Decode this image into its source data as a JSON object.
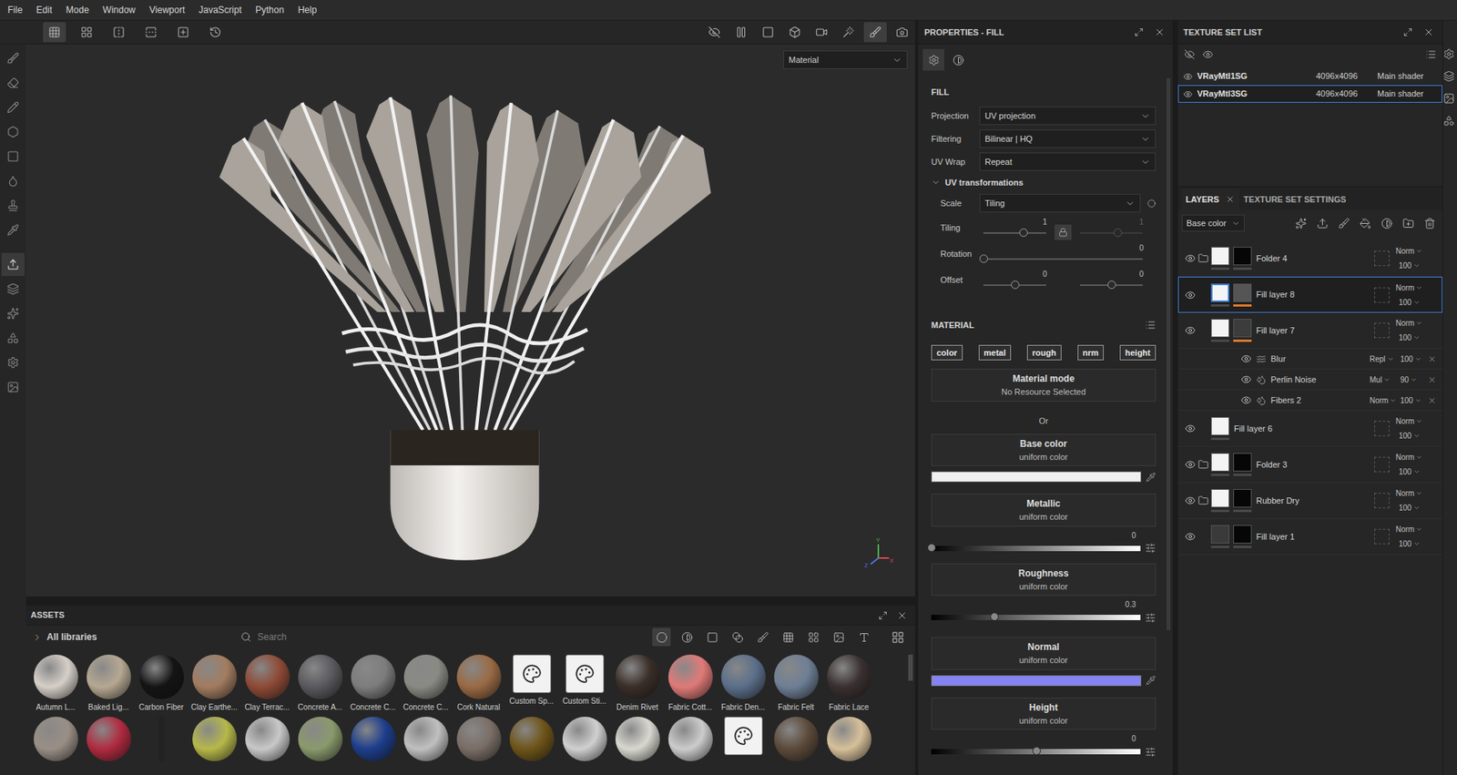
{
  "menu": [
    "File",
    "Edit",
    "Mode",
    "Window",
    "Viewport",
    "JavaScript",
    "Python",
    "Help"
  ],
  "viewport": {
    "shading": "Material",
    "axes": [
      "Y",
      "X",
      "Z"
    ]
  },
  "properties": {
    "title": "PROPERTIES - FILL",
    "tabs": [
      {
        "selected": true
      },
      {
        "selected": false
      }
    ],
    "section": "FILL",
    "fields": [
      {
        "label": "Projection",
        "value": "UV projection"
      },
      {
        "label": "Filtering",
        "value": "Bilinear | HQ"
      },
      {
        "label": "UV Wrap",
        "value": "Repeat"
      }
    ],
    "uv": {
      "title": "UV transformations",
      "expanded": true
    },
    "scale": {
      "label": "Scale",
      "value": "Tiling"
    },
    "sliders": [
      {
        "label": "Tiling",
        "locked": true,
        "tracks": [
          {
            "reading": "1",
            "level": 0.63,
            "disabled": false
          },
          {
            "reading": "1",
            "level": 0.6,
            "disabled": true
          }
        ]
      },
      {
        "label": "Rotation",
        "tracks": [
          {
            "reading": "0",
            "level": 0,
            "disabled": false
          }
        ]
      },
      {
        "label": "Offset",
        "tracks": [
          {
            "reading": "0",
            "level": 0.5,
            "disabled": false
          },
          {
            "reading": "0",
            "level": 0.5,
            "disabled": false
          }
        ]
      }
    ],
    "material": {
      "title": "MATERIAL",
      "channels": [
        {
          "label": "color",
          "on": true
        },
        {
          "label": "metal",
          "on": true
        },
        {
          "label": "rough",
          "on": true
        },
        {
          "label": "nrm",
          "on": true
        },
        {
          "label": "height",
          "on": true
        }
      ],
      "mode": {
        "title": "Material mode",
        "value": "No Resource Selected"
      },
      "or": "Or",
      "maps": [
        {
          "kind": "color",
          "title": "Base color",
          "sub": "uniform color",
          "color": "#f0f0f0"
        },
        {
          "kind": "slider",
          "title": "Metallic",
          "sub": "uniform color",
          "reading": "0",
          "level": 0
        },
        {
          "kind": "slider",
          "title": "Roughness",
          "sub": "uniform color",
          "reading": "0.3",
          "level": 0.3
        },
        {
          "kind": "color",
          "title": "Normal",
          "sub": "uniform color",
          "color": "#8683f4"
        },
        {
          "kind": "slider",
          "title": "Height",
          "sub": "uniform color",
          "reading": "0",
          "level": 0.5
        }
      ]
    }
  },
  "texture_sets": {
    "title": "TEXTURE SET LIST",
    "items": [
      {
        "name": "VRayMtl1SG",
        "size": "4096x4096",
        "shader": "Main shader",
        "visible": true,
        "selected": false
      },
      {
        "name": "VRayMtl3SG",
        "size": "4096x4096",
        "shader": "Main shader",
        "visible": true,
        "selected": true
      }
    ]
  },
  "layers_panel": {
    "tabs": [
      {
        "label": "LAYERS",
        "selected": true,
        "closable": true
      },
      {
        "label": "TEXTURE SET SETTINGS",
        "selected": false,
        "closable": false
      }
    ],
    "channel": "Base color",
    "layers": [
      {
        "kind": "folder",
        "name": "Folder 4",
        "blend": "Norm",
        "opacity": "100",
        "visible": true,
        "selected": false,
        "thumb": "#f4f4f4",
        "mask": "#060606",
        "channel_mark": false
      },
      {
        "kind": "fill",
        "name": "Fill layer 8",
        "blend": "Norm",
        "opacity": "100",
        "visible": true,
        "selected": true,
        "thumb": "#f4f4f4",
        "mask": "#555555",
        "channel_mark": true
      },
      {
        "kind": "fill",
        "name": "Fill layer 7",
        "blend": "Norm",
        "opacity": "100",
        "visible": true,
        "selected": false,
        "thumb": "#f4f4f4",
        "mask": "#3c3c3c",
        "channel_mark": true
      },
      {
        "kind": "effect",
        "name": "Blur",
        "blend": "Repl",
        "opacity": "100",
        "visible": true,
        "selected": false
      },
      {
        "kind": "effect",
        "name": "Perlin Noise",
        "blend": "Mul",
        "opacity": "90",
        "visible": true,
        "selected": false
      },
      {
        "kind": "effect",
        "name": "Fibers 2",
        "blend": "Norm",
        "opacity": "100",
        "visible": true,
        "selected": false
      },
      {
        "kind": "fill",
        "name": "Fill layer 6",
        "blend": "Norm",
        "opacity": "100",
        "visible": true,
        "selected": false,
        "thumb": "#f4f4f4",
        "mask": null,
        "channel_mark": false
      },
      {
        "kind": "folder",
        "name": "Folder 3",
        "blend": "Norm",
        "opacity": "100",
        "visible": true,
        "selected": false,
        "thumb": "#f4f4f4",
        "mask": "#060606",
        "channel_mark": false
      },
      {
        "kind": "folder",
        "name": "Rubber Dry",
        "blend": "Norm",
        "opacity": "100",
        "visible": true,
        "selected": false,
        "thumb": "#f4f4f4",
        "mask": "#060606",
        "channel_mark": false
      },
      {
        "kind": "fill",
        "name": "Fill layer 1",
        "blend": "Norm",
        "opacity": "100",
        "visible": true,
        "selected": false,
        "thumb": "#3a3a3a",
        "mask": "#060606",
        "channel_mark": false
      }
    ]
  },
  "assets": {
    "title": "ASSETS",
    "library": "All libraries",
    "search": "Search",
    "items": [
      {
        "name": "Autumn L...",
        "kind": "sphere",
        "color": "#d6cfc8"
      },
      {
        "name": "Baked Lig...",
        "kind": "sphere",
        "color": "#b6a892"
      },
      {
        "name": "Carbon Fiber",
        "kind": "sphere",
        "color": "#141414"
      },
      {
        "name": "Clay Earthe...",
        "kind": "sphere",
        "color": "#a27c60"
      },
      {
        "name": "Clay Terrac...",
        "kind": "sphere",
        "color": "#8e4a36"
      },
      {
        "name": "Concrete A...",
        "kind": "sphere",
        "color": "#5a5a5e"
      },
      {
        "name": "Concrete C...",
        "kind": "sphere",
        "color": "#7d7d7d"
      },
      {
        "name": "Concrete C...",
        "kind": "sphere",
        "color": "#8a8a84"
      },
      {
        "name": "Cork Natural",
        "kind": "sphere",
        "color": "#9a6a44"
      },
      {
        "name": "Custom Sp...",
        "kind": "icon",
        "color": "#f2f2f2"
      },
      {
        "name": "Custom Sti...",
        "kind": "icon",
        "color": "#f2f2f2"
      },
      {
        "name": "Denim Rivet",
        "kind": "sphere",
        "color": "#3a2e28"
      },
      {
        "name": "Fabric Cott...",
        "kind": "sphere",
        "color": "#e07a78"
      },
      {
        "name": "Fabric Den...",
        "kind": "sphere",
        "color": "#5b6f8a"
      },
      {
        "name": "Fabric Felt",
        "kind": "sphere",
        "color": "#6e7f95"
      },
      {
        "name": "Fabric Lace",
        "kind": "sphere",
        "color": "#3a3030"
      }
    ],
    "more": [
      {
        "kind": "sphere",
        "color": "#9a8f86"
      },
      {
        "kind": "sphere",
        "color": "#b02a40"
      },
      {
        "kind": "stick",
        "color": "#222222"
      },
      {
        "kind": "sphere",
        "color": "#b6b84a"
      },
      {
        "kind": "sphere",
        "color": "#c8c8c8"
      },
      {
        "kind": "sphere",
        "color": "#8a9a6c"
      },
      {
        "kind": "sphere",
        "color": "#1d3e8c"
      },
      {
        "kind": "sphere",
        "color": "#c0c0c0"
      },
      {
        "kind": "sphere",
        "color": "#7a6e66"
      },
      {
        "kind": "sphere",
        "color": "#6e5418"
      },
      {
        "kind": "sphere",
        "color": "#d0d0d0"
      },
      {
        "kind": "sphere",
        "color": "#d8d8d0"
      },
      {
        "kind": "sphere",
        "color": "#cccccc"
      },
      {
        "kind": "icon",
        "color": "#f2f2f2"
      },
      {
        "kind": "sphere",
        "color": "#5c4a3a"
      },
      {
        "kind": "sphere",
        "color": "#d6c09a"
      }
    ]
  }
}
